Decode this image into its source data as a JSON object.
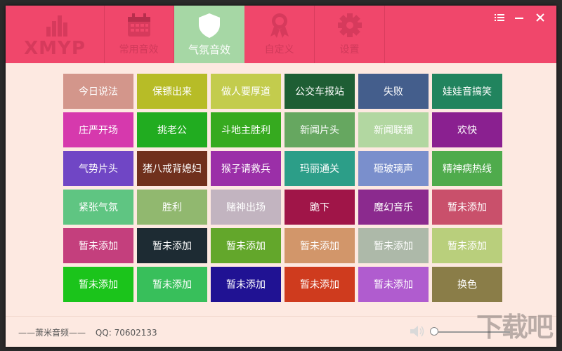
{
  "header": {
    "logo_text": "XMYP",
    "tabs": [
      {
        "label": "常用音效",
        "icon": "calendar-icon"
      },
      {
        "label": "气氛音效",
        "icon": "shield-icon"
      },
      {
        "label": "自定义",
        "icon": "ribbon-award-icon"
      },
      {
        "label": "设置",
        "icon": "gear-icon"
      }
    ],
    "active_tab": "气氛音效"
  },
  "window_controls": {
    "menu": "menu-icon",
    "minimize": "minimize-icon",
    "close": "close-icon"
  },
  "tiles": [
    {
      "label": "今日说法",
      "color": "#d3968b"
    },
    {
      "label": "保镖出来",
      "color": "#b7bc27"
    },
    {
      "label": "做人要厚道",
      "color": "#c3cc4d"
    },
    {
      "label": "公交车报站",
      "color": "#1e5e34"
    },
    {
      "label": "失败",
      "color": "#445e8c"
    },
    {
      "label": "娃娃音搞笑",
      "color": "#21845e"
    },
    {
      "label": "庄严开场",
      "color": "#d639ad"
    },
    {
      "label": "挑老公",
      "color": "#21ac20"
    },
    {
      "label": "斗地主胜利",
      "color": "#36aa1f"
    },
    {
      "label": "新闻片头",
      "color": "#66a760"
    },
    {
      "label": "新闻联播",
      "color": "#b2d7a1"
    },
    {
      "label": "欢快",
      "color": "#8a2090"
    },
    {
      "label": "气势片头",
      "color": "#7046c5"
    },
    {
      "label": "猪八戒背媳妇",
      "color": "#70301d"
    },
    {
      "label": "猴子请救兵",
      "color": "#9b2fa8"
    },
    {
      "label": "玛丽通关",
      "color": "#2c9e88"
    },
    {
      "label": "砸玻璃声",
      "color": "#7a8fcc"
    },
    {
      "label": "精神病热线",
      "color": "#4fab4c"
    },
    {
      "label": "紧张气氛",
      "color": "#5fc582"
    },
    {
      "label": "胜利",
      "color": "#91b86f"
    },
    {
      "label": "赌神出场",
      "color": "#c2b4c0"
    },
    {
      "label": "跪下",
      "color": "#a01548"
    },
    {
      "label": "魔幻音乐",
      "color": "#8b2a8e"
    },
    {
      "label": "暂未添加",
      "color": "#c9506b"
    },
    {
      "label": "暂未添加",
      "color": "#c43f7d"
    },
    {
      "label": "暂未添加",
      "color": "#1d2b33"
    },
    {
      "label": "暂未添加",
      "color": "#63a72b"
    },
    {
      "label": "暂未添加",
      "color": "#d2966a"
    },
    {
      "label": "暂未添加",
      "color": "#adb9a9"
    },
    {
      "label": "暂未添加",
      "color": "#b9cf7c"
    },
    {
      "label": "暂未添加",
      "color": "#1bc41b"
    },
    {
      "label": "暂未添加",
      "color": "#38bf5b"
    },
    {
      "label": "暂未添加",
      "color": "#201293"
    },
    {
      "label": "暂未添加",
      "color": "#cf3b1e"
    },
    {
      "label": "暂未添加",
      "color": "#b05ccf"
    },
    {
      "label": "换色",
      "color": "#8a7d48"
    }
  ],
  "footer": {
    "credit": "——萧米音频——",
    "qq": "QQ: 70602133",
    "volume_icon": "speaker-icon",
    "volume_level": 0
  },
  "watermark": "下载吧"
}
